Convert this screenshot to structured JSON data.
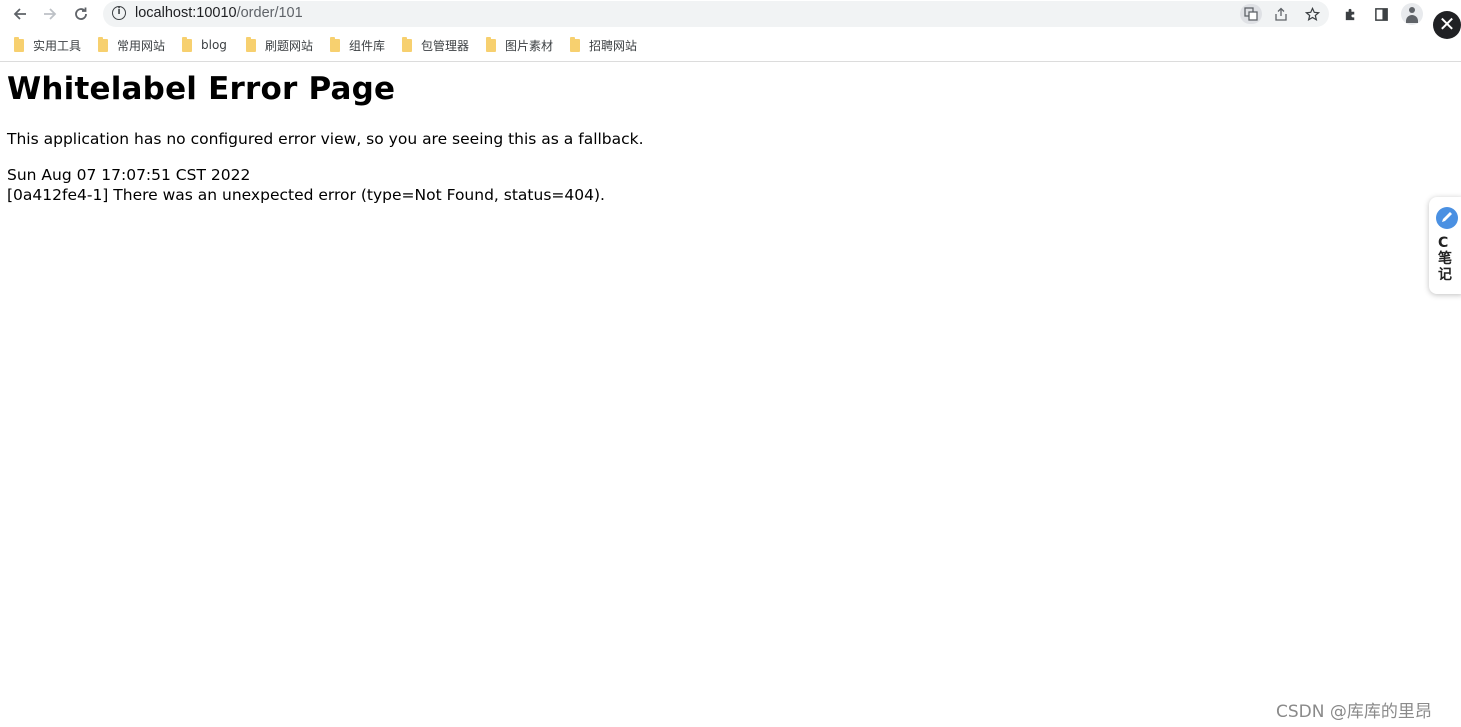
{
  "browser": {
    "url_host": "localhost:10010",
    "url_path": "/order/101",
    "info_glyph": "i",
    "close_glyph": "✕"
  },
  "bookmarks": [
    {
      "label": "实用工具",
      "icon": "folder-icon"
    },
    {
      "label": "常用网站",
      "icon": "folder-icon"
    },
    {
      "label": "blog",
      "icon": "folder-icon"
    },
    {
      "label": "刷题网站",
      "icon": "folder-icon"
    },
    {
      "label": "组件库",
      "icon": "folder-icon"
    },
    {
      "label": "包管理器",
      "icon": "folder-icon"
    },
    {
      "label": "图片素材",
      "icon": "folder-icon"
    },
    {
      "label": "招聘网站",
      "icon": "folder-icon"
    }
  ],
  "page": {
    "title": "Whitelabel Error Page",
    "description": "This application has no configured error view, so you are seeing this as a fallback.",
    "timestamp": "Sun Aug 07 17:07:51 CST 2022",
    "error_message": "[0a412fe4-1] There was an unexpected error (type=Not Found, status=404)."
  },
  "side_widget": {
    "label": "C笔记"
  },
  "watermark": "CSDN @库库的里昂",
  "colors": {
    "omnibox_bg": "#f1f3f4",
    "folder": "#f7d06f",
    "widget_accent": "#4a90e2"
  }
}
